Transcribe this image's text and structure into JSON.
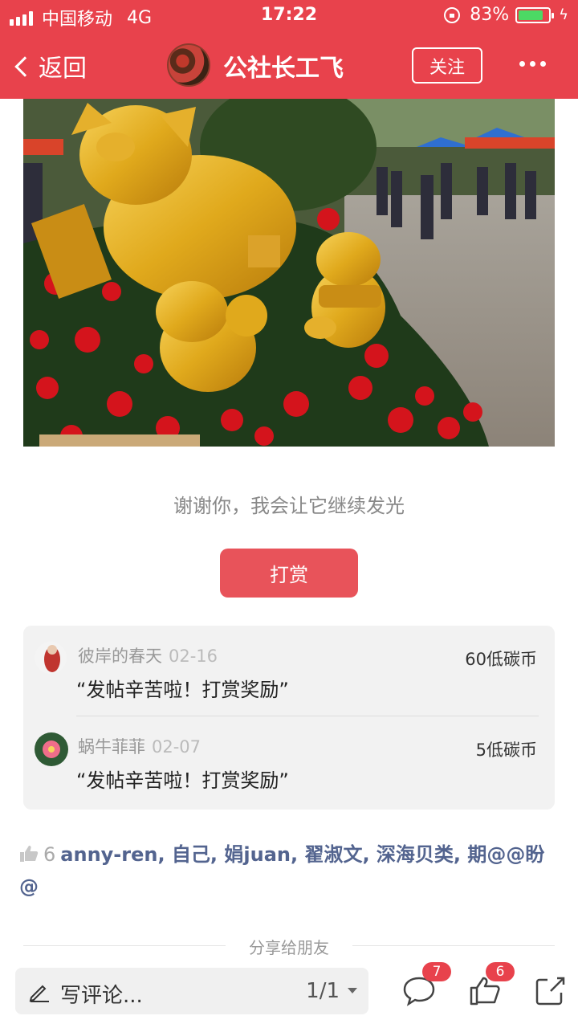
{
  "status_bar": {
    "carrier": "中国移动",
    "network": "4G",
    "time": "17:22",
    "battery": "83%",
    "battery_level": 0.83
  },
  "nav": {
    "back_label": "返回",
    "title": "公社长工飞",
    "follow_label": "关注"
  },
  "post": {
    "thanks_text": "谢谢你，我会让它继续发光",
    "reward_button": "打赏"
  },
  "rewards": [
    {
      "name": "彼岸的春天",
      "date": "02-16",
      "amount": "60低碳币",
      "message": "“发帖辛苦啦！打赏奖励”"
    },
    {
      "name": "蜗牛菲菲",
      "date": "02-07",
      "amount": "5低碳币",
      "message": "“发帖辛苦啦！打赏奖励”"
    }
  ],
  "likes": {
    "count": "6",
    "names": "anny-ren, 自己, 娟juan, 翟淑文, 深海贝类, 期@@盼@"
  },
  "share": {
    "label": "分享给朋友"
  },
  "bottom": {
    "comment_placeholder": "写评论...",
    "page_indicator": "1/1",
    "comment_badge": "7",
    "like_badge": "6"
  },
  "colors": {
    "brand": "#e8424c",
    "link": "#53648f"
  }
}
